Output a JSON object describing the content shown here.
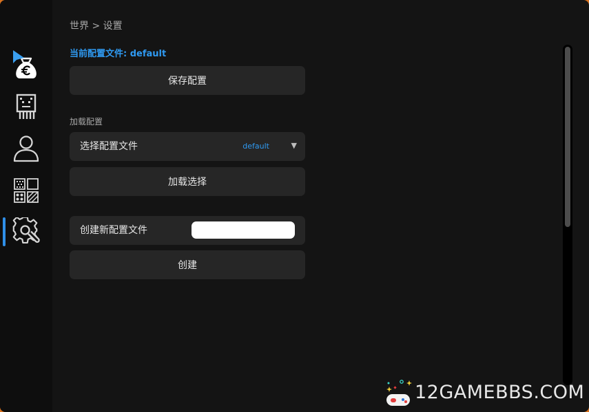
{
  "breadcrumb": "世界 > 设置",
  "current_profile_label": "当前配置文件: default",
  "save_button_label": "保存配置",
  "load_section_label": "加载配置",
  "select_profile": {
    "label": "选择配置文件",
    "selected_value": "default",
    "arrow": "▼"
  },
  "load_button_label": "加载选择",
  "create_profile": {
    "label": "创建新配置文件",
    "input_value": "",
    "input_placeholder": ""
  },
  "create_button_label": "创建",
  "sidebar": {
    "items": [
      {
        "name": "money-bag-euro-icon"
      },
      {
        "name": "robot-icon"
      },
      {
        "name": "user-icon"
      },
      {
        "name": "modules-grid-icon"
      },
      {
        "name": "gear-icon",
        "active": true
      }
    ]
  },
  "watermark": {
    "text": "12GAMEBBS.COM",
    "icon": "gamepad-icon"
  },
  "colors": {
    "accent": "#2f9af2",
    "window_bg": "#141414",
    "sidebar_bg": "#0e0e0e",
    "button_bg": "#262626",
    "text": "#e6e6e6",
    "muted_text": "#a8a8a8"
  }
}
